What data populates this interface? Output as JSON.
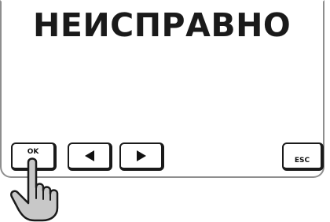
{
  "display": {
    "status_text": "НЕИСПРАВНО"
  },
  "keys": {
    "ok_label": "OK",
    "esc_label": "ESC",
    "left_icon": "left-triangle",
    "right_icon": "right-triangle"
  },
  "pointer": {
    "icon": "pointing-hand"
  },
  "colors": {
    "text": "#1a1a1a",
    "hand_fill": "#c8c8c8",
    "frame": "#8e8e8e"
  }
}
